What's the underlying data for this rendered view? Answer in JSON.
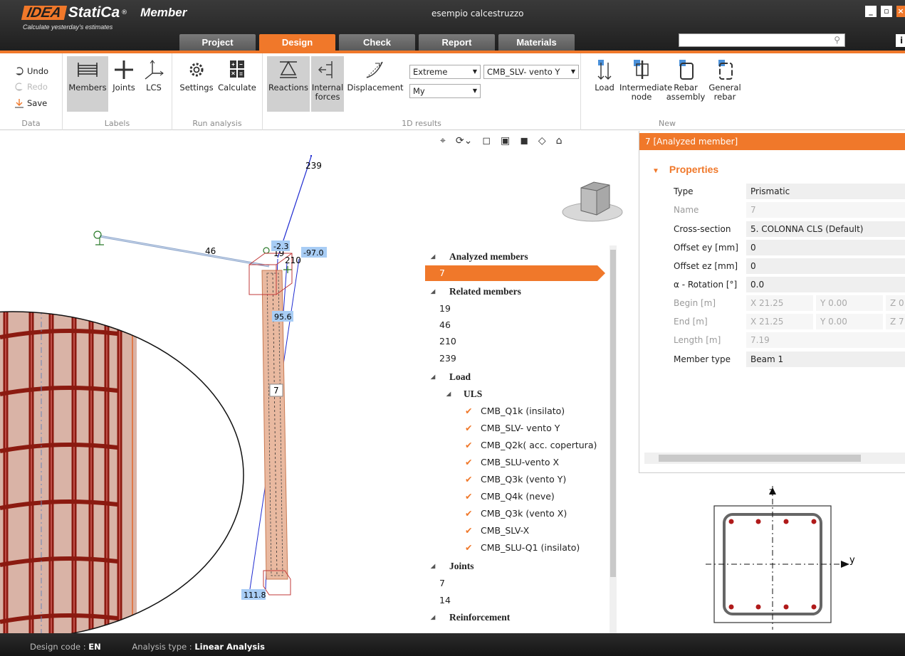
{
  "brand": {
    "mark": "IDEA",
    "name": "StatiCa",
    "reg": "®",
    "app": "Member",
    "slogan": "Calculate yesterday's estimates"
  },
  "window": {
    "title": "esempio calcestruzzo",
    "min": "_",
    "max": "▫",
    "close": "×"
  },
  "tabs": [
    "Project",
    "Design",
    "Check",
    "Report",
    "Materials"
  ],
  "active_tab": "Design",
  "search": {
    "placeholder": ""
  },
  "info_btn": "i",
  "ribbon": {
    "data": {
      "undo": "Undo",
      "redo": "Redo",
      "save": "Save",
      "label": "Data"
    },
    "labels": {
      "members": "Members",
      "joints": "Joints",
      "lcs": "LCS",
      "label": "Labels"
    },
    "run": {
      "settings": "Settings",
      "calculate": "Calculate",
      "label": "Run analysis"
    },
    "results": {
      "reactions": "Reactions",
      "internal_1": "Internal",
      "internal_2": "forces",
      "displacement": "Displacement",
      "extreme": "Extreme",
      "combo": "CMB_SLV- vento Y",
      "component": "My",
      "label": "1D results"
    },
    "new": {
      "load": "Load",
      "inter_1": "Intermediate",
      "inter_2": "node",
      "rebar_1": "Rebar",
      "rebar_2": "assembly",
      "gen_1": "General",
      "gen_2": "rebar",
      "label": "New"
    }
  },
  "view_labels": {
    "n239": "239",
    "n46": "46",
    "n19": "19",
    "n210": "210",
    "n7": "7",
    "v_top": "-2.3",
    "v_right": "-97.0",
    "v_mid": "95.6",
    "v_bot": "111.8"
  },
  "tree": {
    "analyzed": "Analyzed members",
    "analyzed_items": [
      "7"
    ],
    "related": "Related members",
    "related_items": [
      "19",
      "46",
      "210",
      "239"
    ],
    "load": "Load",
    "uls": "ULS",
    "combos": [
      "CMB_Q1k (insilato)",
      "CMB_SLV- vento Y",
      "CMB_Q2k( acc. copertura)",
      "CMB_SLU-vento X",
      "CMB_Q3k (vento Y)",
      "CMB_Q4k (neve)",
      "CMB_Q3k (vento X)",
      "CMB_SLV-X",
      "CMB_SLU-Q1 (insilato)"
    ],
    "joints": "Joints",
    "joint_items": [
      "7",
      "14"
    ],
    "reinforcement": "Reinforcement"
  },
  "panel": {
    "header": "7  [Analyzed member]",
    "section": "Properties",
    "rows": [
      {
        "label": "Type",
        "value": "Prismatic"
      },
      {
        "label": "Name",
        "value": "7"
      },
      {
        "label": "Cross-section",
        "value": "5. COLONNA CLS (Default)"
      },
      {
        "label": "Offset ey [mm]",
        "value": "0"
      },
      {
        "label": "Offset ez [mm]",
        "value": "0"
      },
      {
        "label": "α - Rotation [°]",
        "value": "0.0"
      },
      {
        "label": "Begin [m]",
        "x": "X  21.25",
        "y": "Y  0.00",
        "z": "Z  0"
      },
      {
        "label": "End [m]",
        "x": "X  21.25",
        "y": "Y  0.00",
        "z": "Z  7"
      },
      {
        "label": "Length [m]",
        "value": "7.19"
      },
      {
        "label": "Member type",
        "value": "Beam 1"
      }
    ]
  },
  "xsection": {
    "z": "z",
    "y": "y"
  },
  "status": {
    "code_label": "Design code :",
    "code": "EN",
    "analysis_label": "Analysis type :",
    "analysis": "Linear Analysis"
  },
  "colors": {
    "accent": "#f0782a",
    "member": "#e9b9a0",
    "rebar": "#8b1a10",
    "line": "#1f2bd1"
  }
}
